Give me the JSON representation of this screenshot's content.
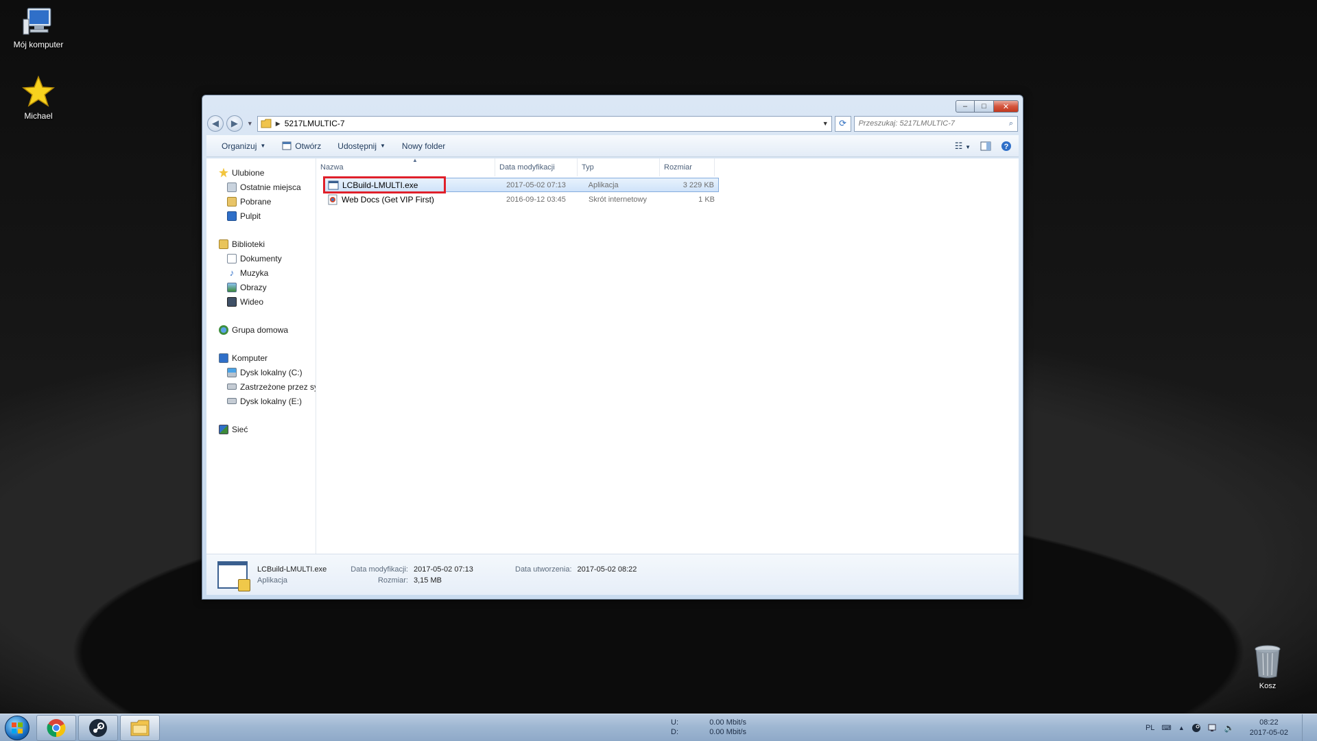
{
  "desktop": {
    "icons": [
      {
        "label": "Mój komputer",
        "icon": "computer-icon"
      },
      {
        "label": "Michael",
        "icon": "star-icon"
      }
    ],
    "recycle_bin": {
      "label": "Kosz",
      "icon": "recycle-bin-icon"
    }
  },
  "window": {
    "controls": {
      "minimize": "–",
      "maximize": "□",
      "close": "✕"
    },
    "address": {
      "path": "5217LMULTIC-7"
    },
    "search": {
      "placeholder": "Przeszukaj: 5217LMULTIC-7"
    },
    "toolbar": {
      "organize": "Organizuj",
      "open": "Otwórz",
      "share": "Udostępnij",
      "new_folder": "Nowy folder"
    },
    "nav": {
      "favorites": {
        "label": "Ulubione",
        "items": [
          "Ostatnie miejsca",
          "Pobrane",
          "Pulpit"
        ]
      },
      "libraries": {
        "label": "Biblioteki",
        "items": [
          "Dokumenty",
          "Muzyka",
          "Obrazy",
          "Wideo"
        ]
      },
      "homegroup": {
        "label": "Grupa domowa"
      },
      "computer": {
        "label": "Komputer",
        "items": [
          "Dysk lokalny (C:)",
          "Zastrzeżone przez sy",
          "Dysk lokalny (E:)"
        ]
      },
      "network": {
        "label": "Sieć"
      }
    },
    "columns": {
      "name": "Nazwa",
      "date": "Data modyfikacji",
      "type": "Typ",
      "size": "Rozmiar"
    },
    "files": [
      {
        "name": "LCBuild-LMULTI.exe",
        "date": "2017-05-02 07:13",
        "type": "Aplikacja",
        "size": "3 229 KB",
        "selected": true,
        "icon": "application-icon"
      },
      {
        "name": "Web Docs (Get VIP First)",
        "date": "2016-09-12 03:45",
        "type": "Skrót internetowy",
        "size": "1 KB",
        "selected": false,
        "icon": "internet-shortcut-icon"
      }
    ],
    "details": {
      "name": "LCBuild-LMULTI.exe",
      "type": "Aplikacja",
      "modified_label": "Data modyfikacji:",
      "modified_value": "2017-05-02 07:13",
      "size_label": "Rozmiar:",
      "size_value": "3,15 MB",
      "created_label": "Data utworzenia:",
      "created_value": "2017-05-02 08:22"
    }
  },
  "taskbar": {
    "apps": [
      "chrome-icon",
      "steam-icon",
      "file-explorer-icon"
    ],
    "netmon": {
      "up_label": "U:",
      "up_value": "0.00 Mbit/s",
      "down_label": "D:",
      "down_value": "0.00 Mbit/s"
    },
    "tray": {
      "language": "PL"
    },
    "clock": {
      "time": "08:22",
      "date": "2017-05-02"
    }
  },
  "colors": {
    "highlight": "#e0202a",
    "selection": "#cfe3fa",
    "taskbar": "#9fb7d2"
  }
}
